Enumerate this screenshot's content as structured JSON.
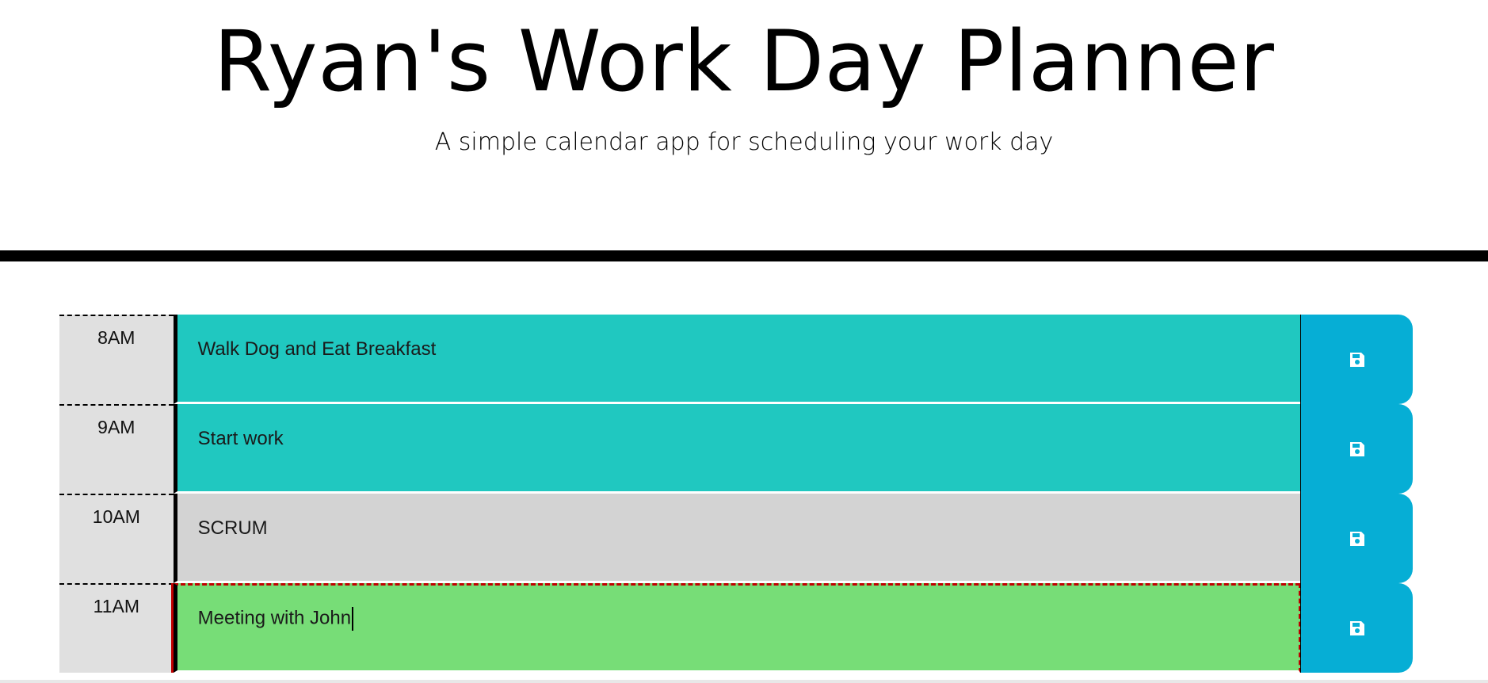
{
  "header": {
    "title": "Ryan's Work Day Planner",
    "subtitle": "A simple calendar app for scheduling your work day"
  },
  "colors": {
    "past": "#d3d3d3",
    "present": "#20c8c0",
    "future": "#77dd77",
    "save_button": "#06aed5",
    "hour_background": "#e0e0e0"
  },
  "rows": [
    {
      "hour": "8AM",
      "text": "Walk Dog and Eat Breakfast",
      "state": "present",
      "icon": "save-icon"
    },
    {
      "hour": "9AM",
      "text": "Start work",
      "state": "present",
      "icon": "save-icon"
    },
    {
      "hour": "10AM",
      "text": "SCRUM",
      "state": "past",
      "icon": "save-icon"
    },
    {
      "hour": "11AM",
      "text": "Meeting with John",
      "state": "future",
      "icon": "save-icon",
      "focused": true
    }
  ]
}
